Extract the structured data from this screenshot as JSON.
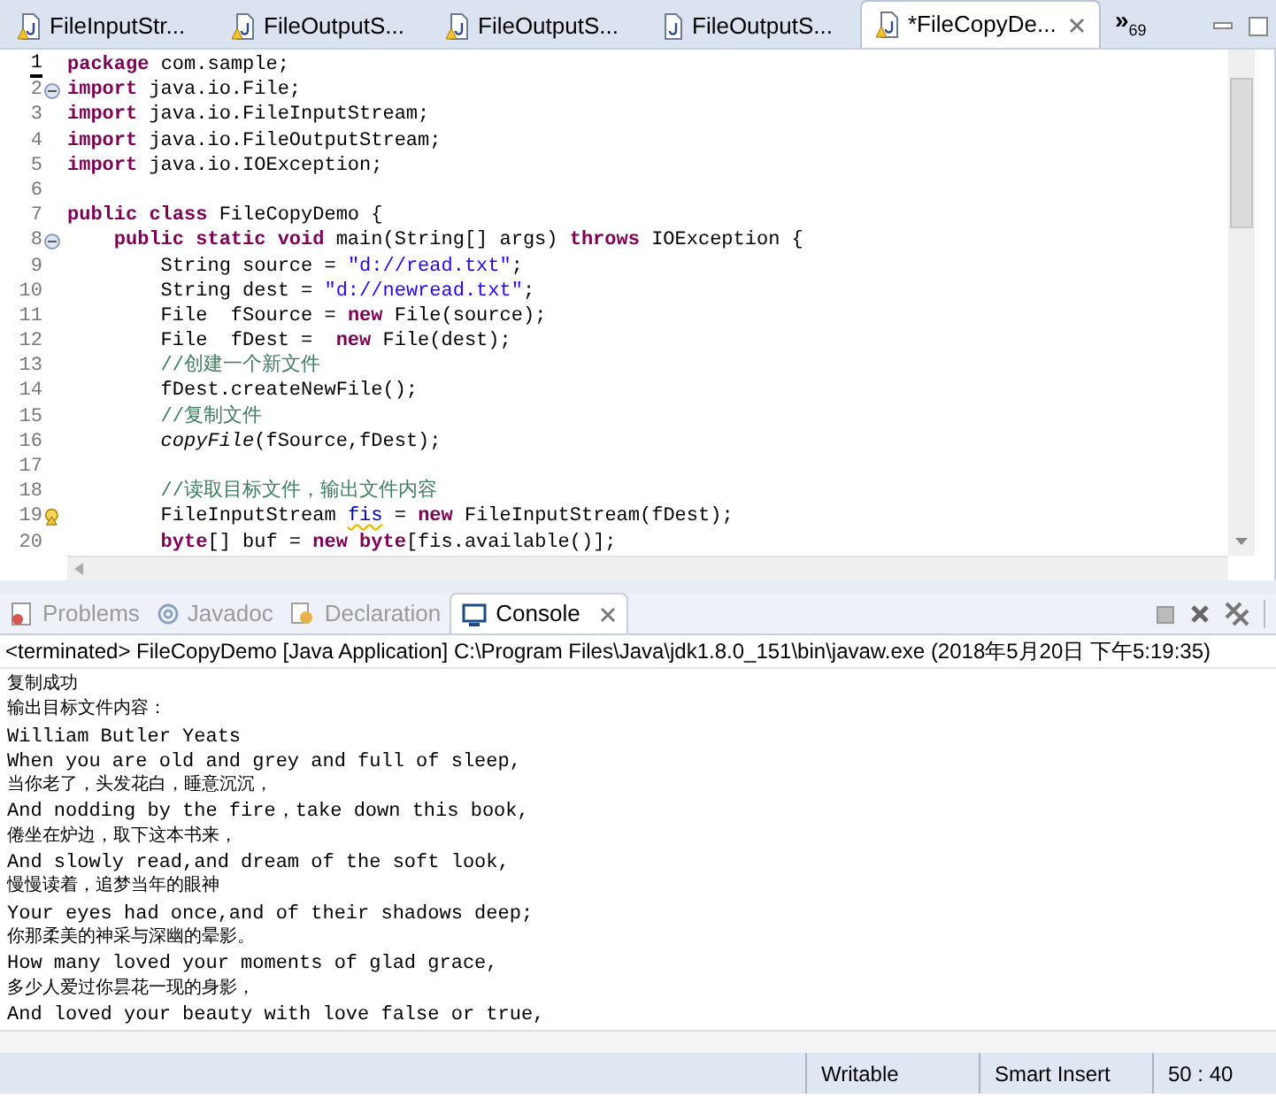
{
  "editor_tabs": [
    {
      "label": "FileInputStr...",
      "selected": false,
      "warning": true
    },
    {
      "label": "FileOutputS...",
      "selected": false,
      "warning": true
    },
    {
      "label": "FileOutputS...",
      "selected": false,
      "warning": true
    },
    {
      "label": "FileOutputS...",
      "selected": false,
      "warning": false
    },
    {
      "label": "*FileCopyDe...",
      "selected": true,
      "warning": true
    }
  ],
  "tab_overflow": {
    "glyph": "»",
    "count": "69"
  },
  "code_lines": [
    {
      "number": "1",
      "fold": false,
      "warning": false,
      "current": true,
      "tokens": [
        {
          "kind": "keyword",
          "text": "package"
        },
        {
          "kind": "plain",
          "text": " com.sample;"
        }
      ]
    },
    {
      "number": "2",
      "fold": true,
      "warning": false,
      "current": false,
      "tokens": [
        {
          "kind": "keyword",
          "text": "import"
        },
        {
          "kind": "plain",
          "text": " java.io.File;"
        }
      ]
    },
    {
      "number": "3",
      "fold": false,
      "warning": false,
      "current": false,
      "tokens": [
        {
          "kind": "keyword",
          "text": "import"
        },
        {
          "kind": "plain",
          "text": " java.io.FileInputStream;"
        }
      ]
    },
    {
      "number": "4",
      "fold": false,
      "warning": false,
      "current": false,
      "tokens": [
        {
          "kind": "keyword",
          "text": "import"
        },
        {
          "kind": "plain",
          "text": " java.io.FileOutputStream;"
        }
      ]
    },
    {
      "number": "5",
      "fold": false,
      "warning": false,
      "current": false,
      "tokens": [
        {
          "kind": "keyword",
          "text": "import"
        },
        {
          "kind": "plain",
          "text": " java.io.IOException;"
        }
      ]
    },
    {
      "number": "6",
      "fold": false,
      "warning": false,
      "current": false
    },
    {
      "number": "7",
      "fold": false,
      "warning": false,
      "current": false,
      "tokens": [
        {
          "kind": "keyword",
          "text": "public class"
        },
        {
          "kind": "plain",
          "text": " FileCopyDemo {"
        }
      ]
    },
    {
      "number": "8",
      "fold": true,
      "warning": false,
      "current": false,
      "tokens": [
        {
          "kind": "keyword",
          "text": "    public static void"
        },
        {
          "kind": "plain",
          "text": " main(String[] args) "
        },
        {
          "kind": "keyword",
          "text": "throws"
        },
        {
          "kind": "plain",
          "text": " IOException {"
        }
      ]
    },
    {
      "number": "9",
      "fold": false,
      "warning": false,
      "current": false,
      "tokens": [
        {
          "kind": "plain",
          "text": "        String source = "
        },
        {
          "kind": "string",
          "text": "\"d://read.txt\""
        },
        {
          "kind": "plain",
          "text": ";"
        }
      ]
    },
    {
      "number": "10",
      "fold": false,
      "warning": false,
      "current": false,
      "tokens": [
        {
          "kind": "plain",
          "text": "        String dest = "
        },
        {
          "kind": "string",
          "text": "\"d://newread.txt\""
        },
        {
          "kind": "plain",
          "text": ";"
        }
      ]
    },
    {
      "number": "11",
      "fold": false,
      "warning": false,
      "current": false,
      "tokens": [
        {
          "kind": "plain",
          "text": "        File  fSource = "
        },
        {
          "kind": "keyword",
          "text": "new"
        },
        {
          "kind": "plain",
          "text": " File(source);"
        }
      ]
    },
    {
      "number": "12",
      "fold": false,
      "warning": false,
      "current": false,
      "tokens": [
        {
          "kind": "plain",
          "text": "        File  fDest =  "
        },
        {
          "kind": "keyword",
          "text": "new"
        },
        {
          "kind": "plain",
          "text": " File(dest);"
        }
      ]
    },
    {
      "number": "13",
      "fold": false,
      "warning": false,
      "current": false,
      "tokens": [
        {
          "kind": "comment",
          "text": "        //创建一个新文件"
        }
      ]
    },
    {
      "number": "14",
      "fold": false,
      "warning": false,
      "current": false,
      "tokens": [
        {
          "kind": "plain",
          "text": "        fDest.createNewFile();"
        }
      ]
    },
    {
      "number": "15",
      "fold": false,
      "warning": false,
      "current": false,
      "tokens": [
        {
          "kind": "comment",
          "text": "        //复制文件"
        }
      ]
    },
    {
      "number": "16",
      "fold": false,
      "warning": false,
      "current": false,
      "tokens": [
        {
          "kind": "static",
          "text": "        copyFile"
        },
        {
          "kind": "plain",
          "text": "(fSource,fDest);"
        }
      ]
    },
    {
      "number": "17",
      "fold": false,
      "warning": false,
      "current": false
    },
    {
      "number": "18",
      "fold": false,
      "warning": false,
      "current": false,
      "tokens": [
        {
          "kind": "comment",
          "text": "        //读取目标文件，输出文件内容"
        }
      ]
    },
    {
      "number": "19",
      "fold": false,
      "warning": true,
      "current": false,
      "tokens": [
        {
          "kind": "plain",
          "text": "        FileInputStream "
        },
        {
          "kind": "unused",
          "text": "fis"
        },
        {
          "kind": "plain",
          "text": " = "
        },
        {
          "kind": "keyword",
          "text": "new"
        },
        {
          "kind": "plain",
          "text": " FileInputStream(fDest);"
        }
      ]
    },
    {
      "number": "20",
      "fold": false,
      "warning": false,
      "current": false,
      "tokens": [
        {
          "kind": "keyword",
          "text": "        byte"
        },
        {
          "kind": "plain",
          "text": "[] buf = "
        },
        {
          "kind": "keyword",
          "text": "new byte"
        },
        {
          "kind": "plain",
          "text": "[fis.available()];"
        }
      ]
    }
  ],
  "view_tabs": [
    {
      "kind": "problems",
      "label": "Problems",
      "selected": false
    },
    {
      "kind": "javadoc",
      "label": "Javadoc",
      "selected": false
    },
    {
      "kind": "declaration",
      "label": "Declaration",
      "selected": false
    },
    {
      "kind": "console",
      "label": "Console",
      "selected": true
    }
  ],
  "console_header": "<terminated> FileCopyDemo [Java Application] C:\\Program Files\\Java\\jdk1.8.0_151\\bin\\javaw.exe (2018年5月20日 下午5:19:35)",
  "console_lines": [
    {
      "kind": "cjk",
      "text": "复制成功"
    },
    {
      "kind": "cjk",
      "text": "输出目标文件内容："
    },
    {
      "kind": "latin",
      "text": "William Butler Yeats"
    },
    {
      "kind": "latin",
      "text": "When you are old and grey and full of sleep,"
    },
    {
      "kind": "cjk",
      "text": "当你老了，头发花白，睡意沉沉，"
    },
    {
      "kind": "latin",
      "text": "And nodding by the fire，take down this book,"
    },
    {
      "kind": "cjk",
      "text": "倦坐在炉边，取下这本书来，"
    },
    {
      "kind": "latin",
      "text": "And slowly read,and dream of the soft look,"
    },
    {
      "kind": "cjk",
      "text": "慢慢读着，追梦当年的眼神"
    },
    {
      "kind": "latin",
      "text": "Your eyes had once,and of their shadows deep;"
    },
    {
      "kind": "cjk",
      "text": "你那柔美的神采与深幽的晕影。"
    },
    {
      "kind": "latin",
      "text": "How many loved your moments of glad grace,"
    },
    {
      "kind": "cjk",
      "text": "多少人爱过你昙花一现的身影，"
    },
    {
      "kind": "latin",
      "text": "And loved your beauty with love false or true,"
    }
  ],
  "status_bar": [
    "Writable",
    "Smart Insert",
    "50 : 40"
  ]
}
